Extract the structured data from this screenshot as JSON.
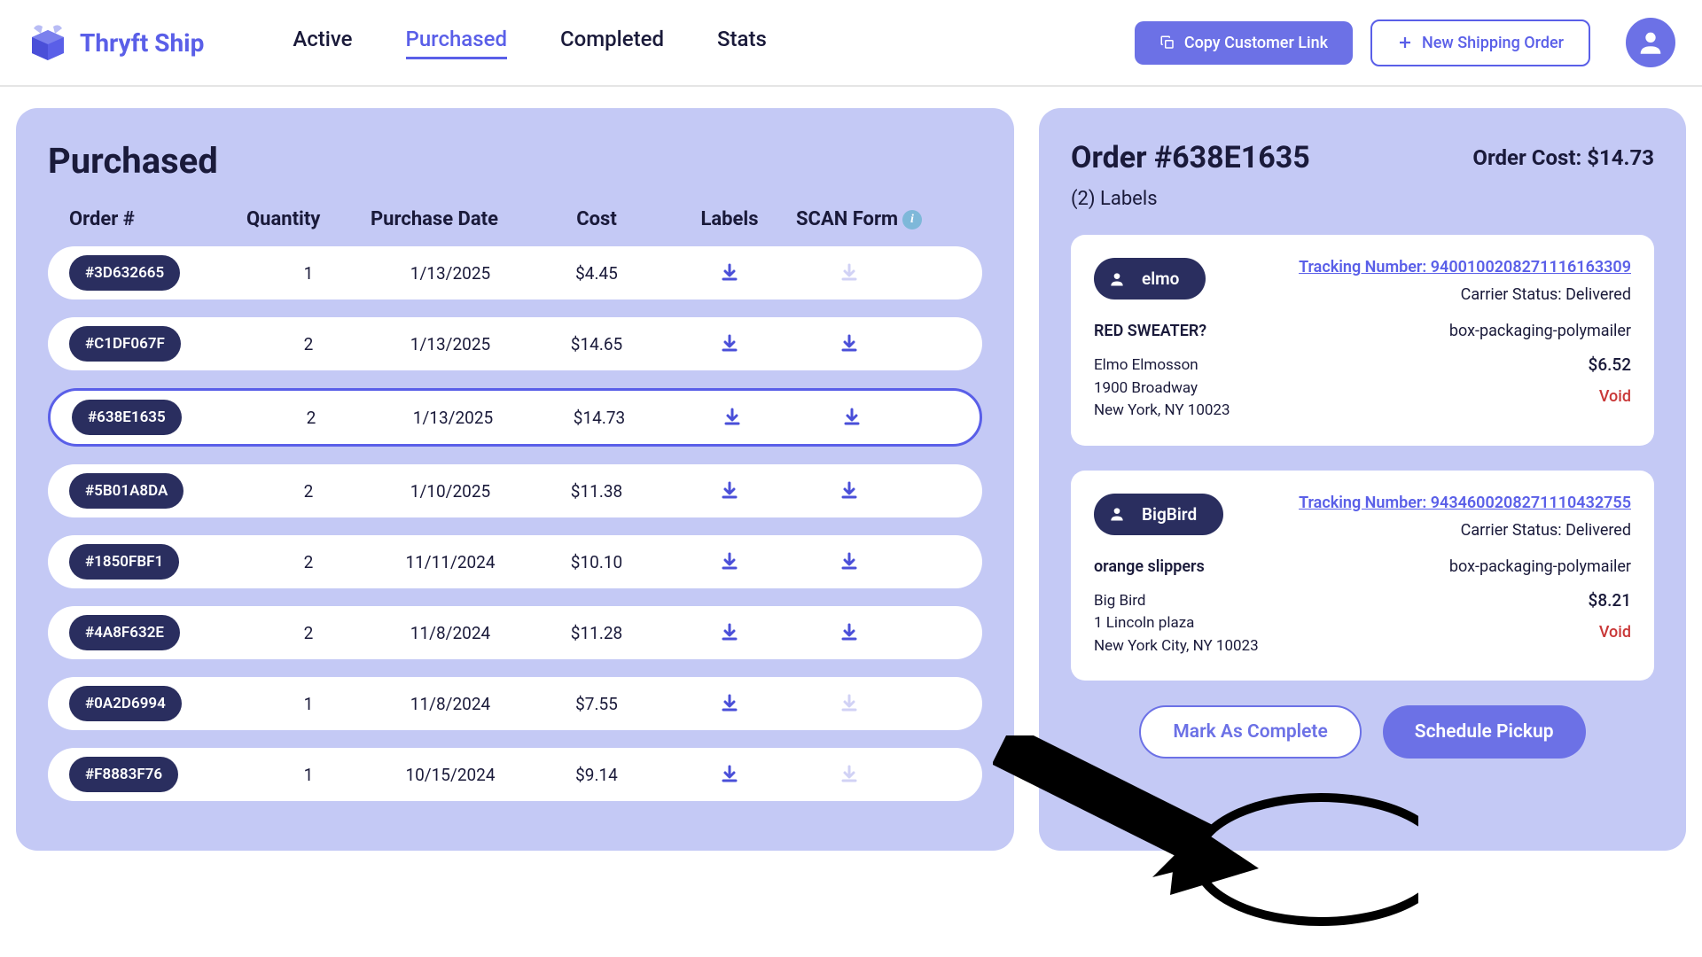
{
  "brand": "Thryft Ship",
  "nav": {
    "items": [
      "Active",
      "Purchased",
      "Completed",
      "Stats"
    ],
    "activeIndex": 1
  },
  "header": {
    "copy_link": "Copy Customer Link",
    "new_order": "New Shipping Order"
  },
  "table": {
    "title": "Purchased",
    "headers": {
      "order": "Order #",
      "qty": "Quantity",
      "date": "Purchase Date",
      "cost": "Cost",
      "labels": "Labels",
      "scan": "SCAN Form"
    },
    "rows": [
      {
        "id": "#3D632665",
        "qty": "1",
        "date": "1/13/2025",
        "cost": "$4.45",
        "scan": false,
        "selected": false
      },
      {
        "id": "#C1DF067F",
        "qty": "2",
        "date": "1/13/2025",
        "cost": "$14.65",
        "scan": true,
        "selected": false
      },
      {
        "id": "#638E1635",
        "qty": "2",
        "date": "1/13/2025",
        "cost": "$14.73",
        "scan": true,
        "selected": true
      },
      {
        "id": "#5B01A8DA",
        "qty": "2",
        "date": "1/10/2025",
        "cost": "$11.38",
        "scan": true,
        "selected": false
      },
      {
        "id": "#1850FBF1",
        "qty": "2",
        "date": "11/11/2024",
        "cost": "$10.10",
        "scan": true,
        "selected": false
      },
      {
        "id": "#4A8F632E",
        "qty": "2",
        "date": "11/8/2024",
        "cost": "$11.28",
        "scan": true,
        "selected": false
      },
      {
        "id": "#0A2D6994",
        "qty": "1",
        "date": "11/8/2024",
        "cost": "$7.55",
        "scan": false,
        "selected": false
      },
      {
        "id": "#F8883F76",
        "qty": "1",
        "date": "10/15/2024",
        "cost": "$9.14",
        "scan": false,
        "selected": false
      }
    ]
  },
  "detail": {
    "title": "Order #638E1635",
    "cost_label": "Order Cost: $14.73",
    "labels_count": "(2) Labels",
    "labels": [
      {
        "user": "elmo",
        "tracking": "Tracking Number: 9400100208271116163309",
        "carrier": "Carrier Status: Delivered",
        "item": "RED SWEATER?",
        "pkg": "box-packaging-polymailer",
        "addr1": "Elmo Elmosson",
        "addr2": "1900 Broadway",
        "addr3": "New York, NY 10023",
        "price": "$6.52",
        "void": "Void"
      },
      {
        "user": "BigBird",
        "tracking": "Tracking Number: 9434600208271110432755",
        "carrier": "Carrier Status: Delivered",
        "item": "orange slippers",
        "pkg": "box-packaging-polymailer",
        "addr1": "Big Bird",
        "addr2": "1 Lincoln plaza",
        "addr3": "New York City, NY 10023",
        "price": "$8.21",
        "void": "Void"
      }
    ],
    "mark_complete": "Mark As Complete",
    "schedule": "Schedule Pickup"
  }
}
